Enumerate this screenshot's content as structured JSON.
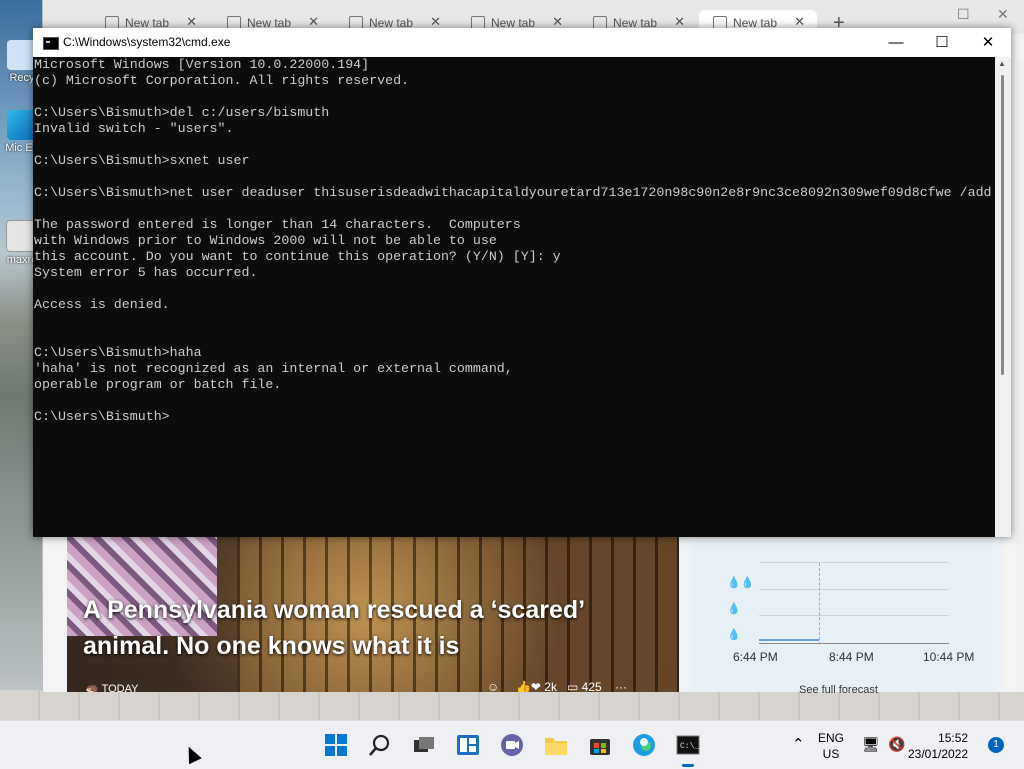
{
  "desktop": {
    "icons": [
      {
        "label": "Recy"
      },
      {
        "label": "Mic Ed"
      },
      {
        "label": "maxre"
      }
    ]
  },
  "browser": {
    "tabs": [
      {
        "label": "New tab",
        "active": false
      },
      {
        "label": "New tab",
        "active": false
      },
      {
        "label": "New tab",
        "active": false
      },
      {
        "label": "New tab",
        "active": false
      },
      {
        "label": "New tab",
        "active": false
      },
      {
        "label": "New tab",
        "active": true
      }
    ],
    "new_tab_symbol": "+",
    "news": {
      "title": "A Pennsylvania woman rescued a ‘scared’ animal. No one knows what it is",
      "source": "TODAY",
      "likes": "2k",
      "comments": "425",
      "more": "···"
    },
    "weather": {
      "times": [
        "6:44 PM",
        "8:44 PM",
        "10:44 PM"
      ],
      "forecast_link": "See full forecast"
    }
  },
  "cmd": {
    "title": "C:\\Windows\\system32\\cmd.exe",
    "lines": [
      "Microsoft Windows [Version 10.0.22000.194]",
      "(c) Microsoft Corporation. All rights reserved.",
      "",
      "C:\\Users\\Bismuth>del c:/users/bismuth",
      "Invalid switch - \"users\".",
      "",
      "C:\\Users\\Bismuth>sxnet user",
      "",
      "C:\\Users\\Bismuth>net user deaduser thisuserisdeadwithacapitaldyouretard713e1720n98c90n2e8r9nc3ce8092n309wef09d8cfwe /add",
      "",
      "The password entered is longer than 14 characters.  Computers",
      "with Windows prior to Windows 2000 will not be able to use",
      "this account. Do you want to continue this operation? (Y/N) [Y]: y",
      "System error 5 has occurred.",
      "",
      "Access is denied.",
      "",
      "",
      "C:\\Users\\Bismuth>haha",
      "'haha' is not recognized as an internal or external command,",
      "operable program or batch file.",
      "",
      "C:\\Users\\Bismuth>"
    ]
  },
  "taskbar": {
    "apps": [
      "start-icon",
      "search-icon",
      "task-view-icon",
      "widgets-icon",
      "chat-icon",
      "file-explorer-icon",
      "store-icon",
      "edge-icon",
      "terminal-icon"
    ],
    "language": "ENG",
    "region": "US",
    "time": "15:52",
    "date": "23/01/2022",
    "notifications": "1"
  },
  "colors": {
    "console_bg": "#0c0c0c",
    "console_fg": "#cccccc",
    "accent": "#0067c0"
  }
}
